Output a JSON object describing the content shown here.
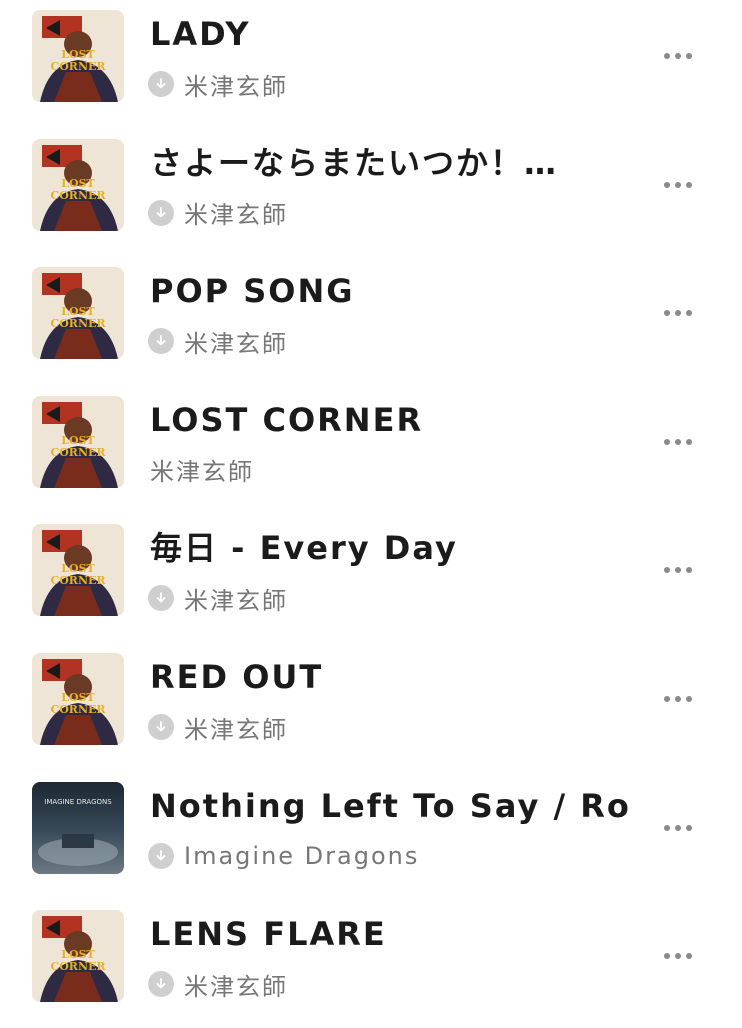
{
  "songs": [
    {
      "title": "LADY",
      "artist": "米津玄師",
      "downloaded": true,
      "cover": "lost-corner"
    },
    {
      "title": "さよーならまたいつか！…",
      "artist": "米津玄師",
      "downloaded": true,
      "cover": "lost-corner"
    },
    {
      "title": "POP SONG",
      "artist": "米津玄師",
      "downloaded": true,
      "cover": "lost-corner"
    },
    {
      "title": "LOST CORNER",
      "artist": "米津玄師",
      "downloaded": false,
      "cover": "lost-corner"
    },
    {
      "title": "毎日 - Every Day",
      "artist": "米津玄師",
      "downloaded": true,
      "cover": "lost-corner"
    },
    {
      "title": "RED OUT",
      "artist": "米津玄師",
      "downloaded": true,
      "cover": "lost-corner"
    },
    {
      "title": "Nothing Left To Say / Ro…",
      "artist": "Imagine Dragons",
      "downloaded": true,
      "cover": "night-visions"
    },
    {
      "title": "LENS FLARE",
      "artist": "米津玄師",
      "downloaded": true,
      "cover": "lost-corner"
    }
  ],
  "covers": {
    "lost-corner": {
      "text": "LOST CORNER",
      "text_color": "#e8b021"
    },
    "night-visions": {
      "text": "IMAGINE DRAGONS",
      "text_color": "#e6e6e6"
    }
  },
  "colors": {
    "title": "#1b1b1b",
    "artist": "#777777",
    "download_badge": "#cfcfcf",
    "more_dots": "#8a8a8a"
  },
  "icons": {
    "download": "download-icon",
    "more": "more-options-icon"
  }
}
